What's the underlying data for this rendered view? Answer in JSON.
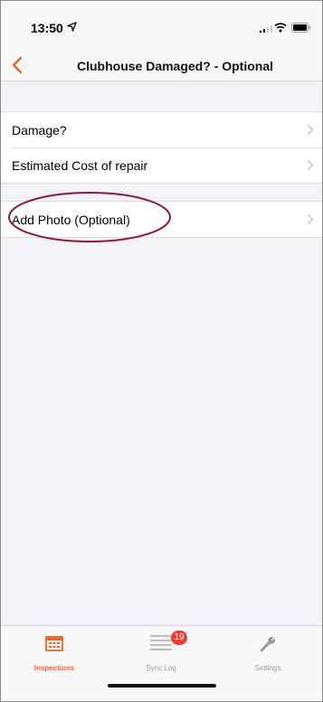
{
  "status": {
    "time": "13:50"
  },
  "nav": {
    "title": "Clubhouse Damaged? - Optional"
  },
  "sections": [
    {
      "rows": [
        {
          "label": "Damage?"
        },
        {
          "label": "Estimated Cost of repair"
        }
      ]
    },
    {
      "rows": [
        {
          "label": "Add Photo (Optional)"
        }
      ]
    }
  ],
  "tabs": [
    {
      "label": "Inspections",
      "icon": "calendar-icon",
      "active": true
    },
    {
      "label": "Sync Log",
      "icon": "list-icon",
      "badge": "19"
    },
    {
      "label": "Settings",
      "icon": "wrench-icon"
    }
  ],
  "colors": {
    "accent": "#e8672a",
    "badge": "#f03c2e",
    "annotation": "#8b1a3a"
  }
}
